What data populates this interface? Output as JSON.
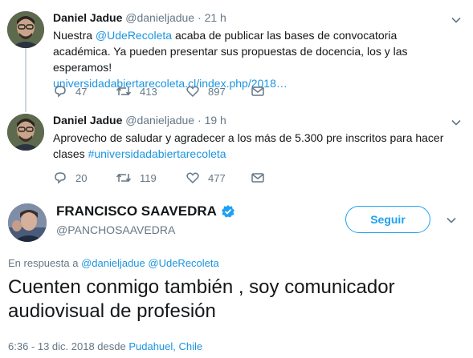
{
  "thread": [
    {
      "author_name": "Daniel Jadue",
      "author_handle": "@danieljadue",
      "separator": "·",
      "time": "21 h",
      "text_1": "Nuestra ",
      "mention": "@UdeRecoleta",
      "text_2": " acaba de publicar las bases de convocatoria académica. Ya pueden presentar sus propuestas de docencia, los y las esperamos!",
      "url": "universidadabiertarecoleta.cl/index.php/2018…",
      "replies": "47",
      "retweets": "413",
      "likes": "897"
    },
    {
      "author_name": "Daniel Jadue",
      "author_handle": "@danieljadue",
      "separator": "·",
      "time": "19 h",
      "text_1": "Aprovecho de saludar y agradecer a los más de 5.300 pre inscritos para hacer clases ",
      "hashtag": "#universidadabiertarecoleta",
      "replies": "20",
      "retweets": "119",
      "likes": "477"
    }
  ],
  "main_tweet": {
    "author_name": "FRANCISCO SAAVEDRA",
    "author_handle": "@PANCHOSAAVEDRA",
    "follow_label": "Seguir",
    "reply_prefix": "En respuesta a ",
    "reply_mention_1": "@danieljadue",
    "reply_mention_2": "@UdeRecoleta",
    "text": "Cuenten conmigo también , soy comunicador audiovisual de profesión",
    "timestamp": "6:36 - 13 dic. 2018 desde ",
    "location": "Pudahuel, Chile"
  },
  "colors": {
    "link": "#1b95e0",
    "accent": "#1da1f2",
    "muted": "#657786",
    "text": "#14171a"
  },
  "icons": [
    "reply-icon",
    "retweet-icon",
    "like-icon",
    "dm-icon",
    "chevron-down-icon",
    "verified-icon"
  ]
}
